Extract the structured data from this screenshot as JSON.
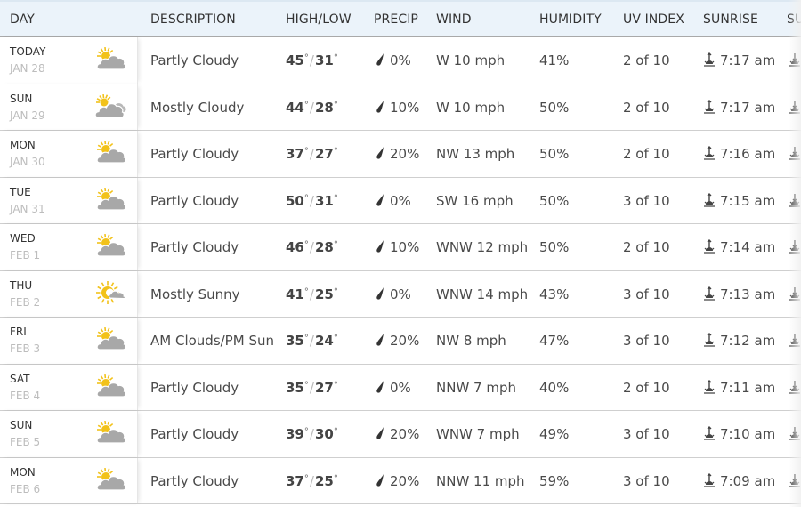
{
  "table": {
    "headers": {
      "day": "DAY",
      "description": "DESCRIPTION",
      "high_low": "HIGH/LOW",
      "precip": "PRECIP",
      "wind": "WIND",
      "humidity": "HUMIDITY",
      "uv_index": "UV INDEX",
      "sunrise": "SUNRISE",
      "sunset_clipped": "SU"
    },
    "degree_symbol": "°",
    "slash": "/",
    "rows": [
      {
        "day": "TODAY",
        "date": "JAN 28",
        "icon": "partly-cloudy-icon",
        "description": "Partly Cloudy",
        "high": "45",
        "low": "31",
        "precip": "0%",
        "wind": "W 10 mph",
        "humidity": "41%",
        "uv": "2 of 10",
        "sunrise": "7:17 am"
      },
      {
        "day": "SUN",
        "date": "JAN 29",
        "icon": "mostly-cloudy-icon",
        "description": "Mostly Cloudy",
        "high": "44",
        "low": "28",
        "precip": "10%",
        "wind": "W 10 mph",
        "humidity": "50%",
        "uv": "2 of 10",
        "sunrise": "7:17 am"
      },
      {
        "day": "MON",
        "date": "JAN 30",
        "icon": "partly-cloudy-icon",
        "description": "Partly Cloudy",
        "high": "37",
        "low": "27",
        "precip": "20%",
        "wind": "NW 13 mph",
        "humidity": "50%",
        "uv": "2 of 10",
        "sunrise": "7:16 am"
      },
      {
        "day": "TUE",
        "date": "JAN 31",
        "icon": "partly-cloudy-icon",
        "description": "Partly Cloudy",
        "high": "50",
        "low": "31",
        "precip": "0%",
        "wind": "SW 16 mph",
        "humidity": "50%",
        "uv": "3 of 10",
        "sunrise": "7:15 am"
      },
      {
        "day": "WED",
        "date": "FEB 1",
        "icon": "partly-cloudy-icon",
        "description": "Partly Cloudy",
        "high": "46",
        "low": "28",
        "precip": "10%",
        "wind": "WNW 12 mph",
        "humidity": "50%",
        "uv": "2 of 10",
        "sunrise": "7:14 am"
      },
      {
        "day": "THU",
        "date": "FEB 2",
        "icon": "mostly-sunny-icon",
        "description": "Mostly Sunny",
        "high": "41",
        "low": "25",
        "precip": "0%",
        "wind": "WNW 14 mph",
        "humidity": "43%",
        "uv": "3 of 10",
        "sunrise": "7:13 am"
      },
      {
        "day": "FRI",
        "date": "FEB 3",
        "icon": "partly-cloudy-icon",
        "description": "AM Clouds/PM Sun",
        "high": "35",
        "low": "24",
        "precip": "20%",
        "wind": "NW 8 mph",
        "humidity": "47%",
        "uv": "3 of 10",
        "sunrise": "7:12 am"
      },
      {
        "day": "SAT",
        "date": "FEB 4",
        "icon": "partly-cloudy-icon",
        "description": "Partly Cloudy",
        "high": "35",
        "low": "27",
        "precip": "0%",
        "wind": "NNW 7 mph",
        "humidity": "40%",
        "uv": "2 of 10",
        "sunrise": "7:11 am"
      },
      {
        "day": "SUN",
        "date": "FEB 5",
        "icon": "partly-cloudy-icon",
        "description": "Partly Cloudy",
        "high": "39",
        "low": "30",
        "precip": "20%",
        "wind": "WNW 7 mph",
        "humidity": "49%",
        "uv": "3 of 10",
        "sunrise": "7:10 am"
      },
      {
        "day": "MON",
        "date": "FEB 6",
        "icon": "partly-cloudy-icon",
        "description": "Partly Cloudy",
        "high": "37",
        "low": "25",
        "precip": "20%",
        "wind": "NNW 11 mph",
        "humidity": "59%",
        "uv": "3 of 10",
        "sunrise": "7:09 am"
      }
    ]
  },
  "colors": {
    "header_bg": "#ebf3fa",
    "sun_yellow": "#f2c21a",
    "cloud_gray": "#a8a8a8",
    "date_gray": "#bdbdbd"
  }
}
